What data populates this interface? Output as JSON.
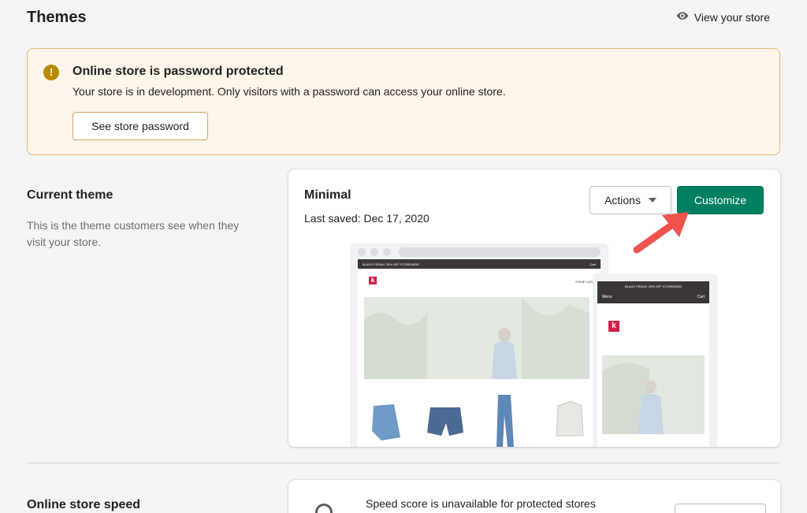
{
  "header": {
    "title": "Themes",
    "view_store_label": "View your store"
  },
  "banner": {
    "title": "Online store is password protected",
    "text": "Your store is in development. Only visitors with a password can access your online store.",
    "button_label": "See store password",
    "icon": "alert-circle-icon",
    "icon_glyph": "!"
  },
  "current_theme": {
    "section_title": "Current theme",
    "section_description": "This is the theme customers see when they visit your store.",
    "theme_name": "Minimal",
    "last_saved": "Last saved: Dec 17, 2020",
    "actions_label": "Actions",
    "customize_label": "Customize",
    "preview": {
      "desktop_banner": "BLACK FRIDAY 25% OFF STOREWIDE",
      "desktop_cart": "Cart",
      "desktop_nav_links": "HOME   CATALOG",
      "logo_letter": "k",
      "mobile_banner": "BLACK FRIDAY 25% OFF STOREWIDE",
      "mobile_menu": "Menu",
      "mobile_cart": "Cart"
    }
  },
  "speed": {
    "section_title": "Online store speed",
    "text": "Speed score is unavailable for protected stores"
  },
  "colors": {
    "accent": "#008060",
    "banner_bg": "#fff5ea",
    "banner_border": "#e1b878",
    "warning_icon": "#b98900",
    "arrow": "#f0524e",
    "logo": "#d3204a"
  }
}
